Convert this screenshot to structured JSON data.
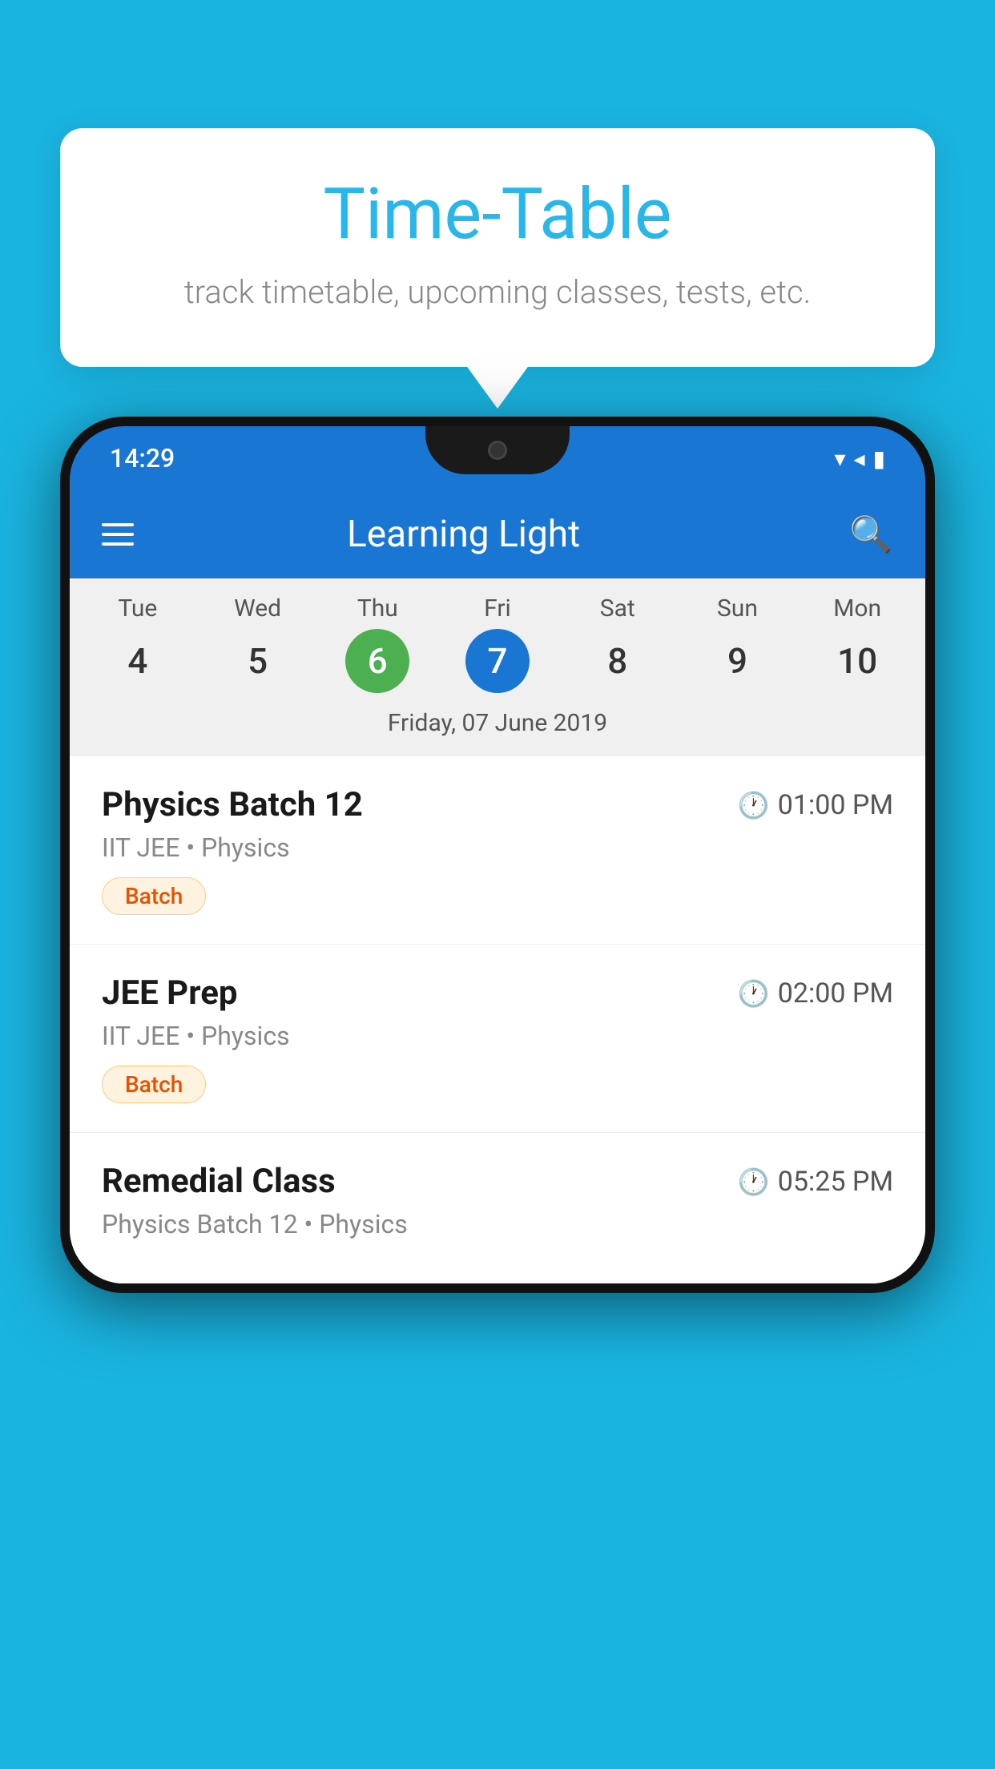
{
  "background_color": "#1ab4e0",
  "tooltip": {
    "title": "Time-Table",
    "subtitle": "track timetable, upcoming classes, tests, etc."
  },
  "phone": {
    "status_bar": {
      "time": "14:29"
    },
    "app_bar": {
      "title": "Learning Light"
    },
    "calendar": {
      "days": [
        {
          "name": "Tue",
          "num": "4",
          "state": "normal"
        },
        {
          "name": "Wed",
          "num": "5",
          "state": "normal"
        },
        {
          "name": "Thu",
          "num": "6",
          "state": "today"
        },
        {
          "name": "Fri",
          "num": "7",
          "state": "selected"
        },
        {
          "name": "Sat",
          "num": "8",
          "state": "normal"
        },
        {
          "name": "Sun",
          "num": "9",
          "state": "normal"
        },
        {
          "name": "Mon",
          "num": "10",
          "state": "normal"
        }
      ],
      "selected_date": "Friday, 07 June 2019"
    },
    "classes": [
      {
        "name": "Physics Batch 12",
        "time": "01:00 PM",
        "subject": "IIT JEE • Physics",
        "tag": "Batch"
      },
      {
        "name": "JEE Prep",
        "time": "02:00 PM",
        "subject": "IIT JEE • Physics",
        "tag": "Batch"
      },
      {
        "name": "Remedial Class",
        "time": "05:25 PM",
        "subject": "Physics Batch 12 • Physics",
        "tag": null
      }
    ]
  }
}
